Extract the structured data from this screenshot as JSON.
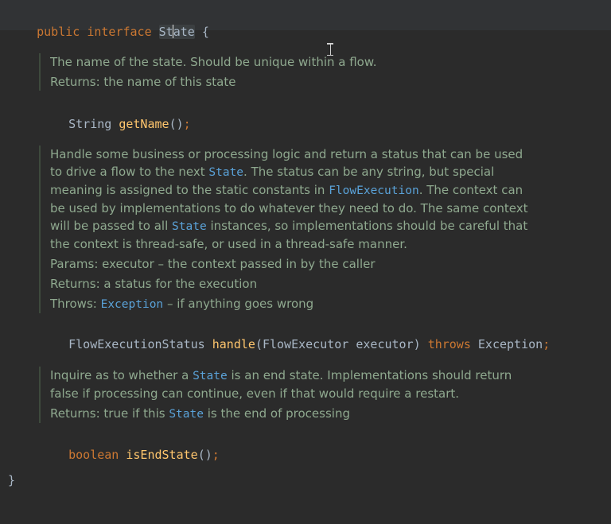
{
  "code": {
    "line1": {
      "modifier": "public",
      "keyword": "interface",
      "name_part1": "St",
      "name_part2": "ate",
      "brace_open": "{"
    },
    "method1": {
      "return_type": "String",
      "name": "getName",
      "params": "()",
      "semicolon": ";"
    },
    "method2": {
      "return_type": "FlowExecutionStatus",
      "name": "handle",
      "params": "(FlowExecutor executor)",
      "throws_kw": "throws",
      "exception": "Exception",
      "semicolon": ";"
    },
    "method3": {
      "return_type": "boolean",
      "name": "isEndState",
      "params": "()",
      "semicolon": ";"
    },
    "brace_close": "}"
  },
  "docs": {
    "getName": {
      "description": "The name of the state. Should be unique within a flow.",
      "returns": "Returns: the name of this state"
    },
    "handle": {
      "d1": "Handle some business or processing logic and return a status that can be used to drive a flow to the next ",
      "d1_link": "State",
      "d2": ". The status can be any string, but special meaning is assigned to the static constants in ",
      "d2_link": "FlowExecution",
      "d3": ". The context can be used by implementations to do whatever they need to do. The same context will be passed to all ",
      "d3_link": "State",
      "d4": " instances, so implementations should be careful that the context is thread-safe, or used in a thread-safe manner.",
      "params": "Params:  executor – the context passed in by the caller",
      "returns": "Returns: a status for the execution",
      "throws_label": "Throws: ",
      "throws_link": "Exception",
      "throws_rest": " – if anything goes wrong"
    },
    "isEndState": {
      "d1": "Inquire as to whether a ",
      "d1_link": "State",
      "d2": " is an end state. Implementations should return false if processing can continue, even if that would require a restart.",
      "returns_pre": "Returns: true if this ",
      "returns_link": "State",
      "returns_post": " is the end of processing"
    }
  }
}
